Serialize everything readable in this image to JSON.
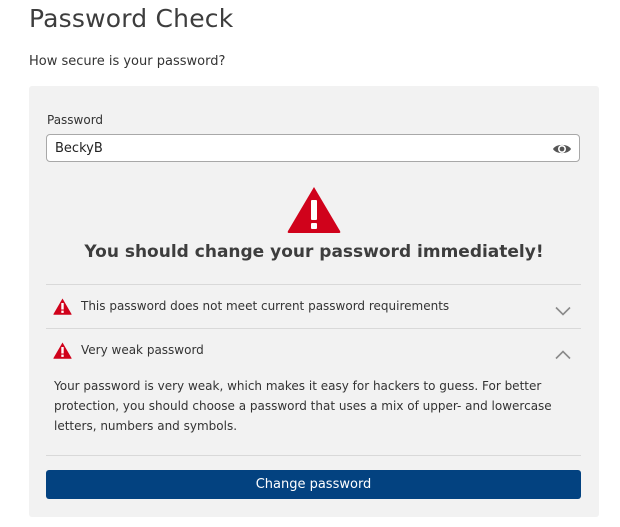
{
  "header": {
    "title": "Password Check",
    "subtitle": "How secure is your password?"
  },
  "password_field": {
    "label": "Password",
    "value": "BeckyB",
    "toggle_icon": "eye-icon"
  },
  "result": {
    "icon": "warning-triangle-icon",
    "headline": "You should change your password immediately!"
  },
  "accordion": [
    {
      "icon": "warning-triangle-icon",
      "label": "This password does not meet current password requirements",
      "expanded": false,
      "chevron": "chevron-down-icon"
    },
    {
      "icon": "warning-triangle-icon",
      "label": "Very weak password",
      "expanded": true,
      "chevron": "chevron-up-icon",
      "body": "Your password is very weak, which makes it easy for hackers to guess. For better protection, you should choose a password that uses a mix of upper- and lowercase letters, numbers and symbols."
    }
  ],
  "actions": {
    "change_password_label": "Change password"
  },
  "colors": {
    "warning_red": "#d0021b",
    "primary_blue": "#034280",
    "card_background": "#f2f2f2"
  }
}
